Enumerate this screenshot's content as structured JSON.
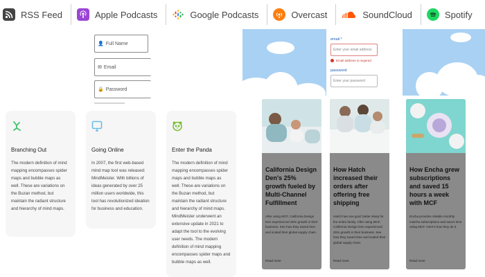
{
  "podcast_bar": {
    "items": [
      {
        "label": "RSS Feed",
        "icon": "rss-icon",
        "color": "#444444"
      },
      {
        "label": "Apple Podcasts",
        "icon": "apple-podcasts-icon",
        "color": "#9b45d6"
      },
      {
        "label": "Google Podcasts",
        "icon": "google-podcasts-icon",
        "color": "#4285f4"
      },
      {
        "label": "Overcast",
        "icon": "overcast-icon",
        "color": "#fc7e0f"
      },
      {
        "label": "SoundCloud",
        "icon": "soundcloud-icon",
        "color": "#ff5500"
      },
      {
        "label": "Spotify",
        "icon": "spotify-icon",
        "color": "#1ed760"
      }
    ]
  },
  "signup_form": {
    "fullname_placeholder": "Full Name",
    "email_placeholder": "Email",
    "password_placeholder": "Password"
  },
  "features": [
    {
      "icon": "branching-icon",
      "accent": "#3ec36a",
      "title": "Branching Out",
      "text": "The modern definition of mind mapping encompasses spider maps and bubble maps as well. These are variations on the Buzan method, but maintain the radiant structure and hierarchy of mind maps."
    },
    {
      "icon": "monitor-icon",
      "accent": "#6bbce8",
      "title": "Going Online",
      "text": "In 2007, the first web-based mind map tool was released: MindMeister. With billions of ideas generated by over 25 million users worldwide, this tool has revolutionized ideation for business and education."
    },
    {
      "icon": "panda-icon",
      "accent": "#7cbf3a",
      "title": "Enter the Panda",
      "text": "The modern definition of mind mapping encompasses spider maps and bubble maps as well. These are variations on the Buzan method, but maintain the radiant structure and hierarchy of mind maps. MindMeister underwent an extensive update in 2021 to adapt the tool to the evolving user needs. The modern definition of mind mapping encompasses spider maps and bubble maps as well."
    }
  ],
  "login": {
    "email_label": "email *",
    "email_placeholder": "Enter your email address",
    "email_error": "Email address is required",
    "password_label": "password",
    "password_placeholder": "Enter your password"
  },
  "cases": [
    {
      "title": "California Design Den's 25% growth fueled by Multi-Channel Fulfillment",
      "text": "After using MCF, California Design Den experienced 25% growth in their business. See how they saved time and scaled their global supply chain.",
      "link": "Read more"
    },
    {
      "title": "How Hatch increased their orders after offering free shipping",
      "text": "Hatch has one goal: better sleep for the entire family. After using MCF, California Design Den experienced 25% growth in their business. See how they saved time and scaled their global supply chain.",
      "link": "Read more"
    },
    {
      "title": "How Encha grew subscriptions and saved 15 hours a week with MCF",
      "text": "Encha provides reliable monthly matcha subscriptions and saves time using MCF. Here's how they do it.",
      "link": "Read more"
    }
  ]
}
